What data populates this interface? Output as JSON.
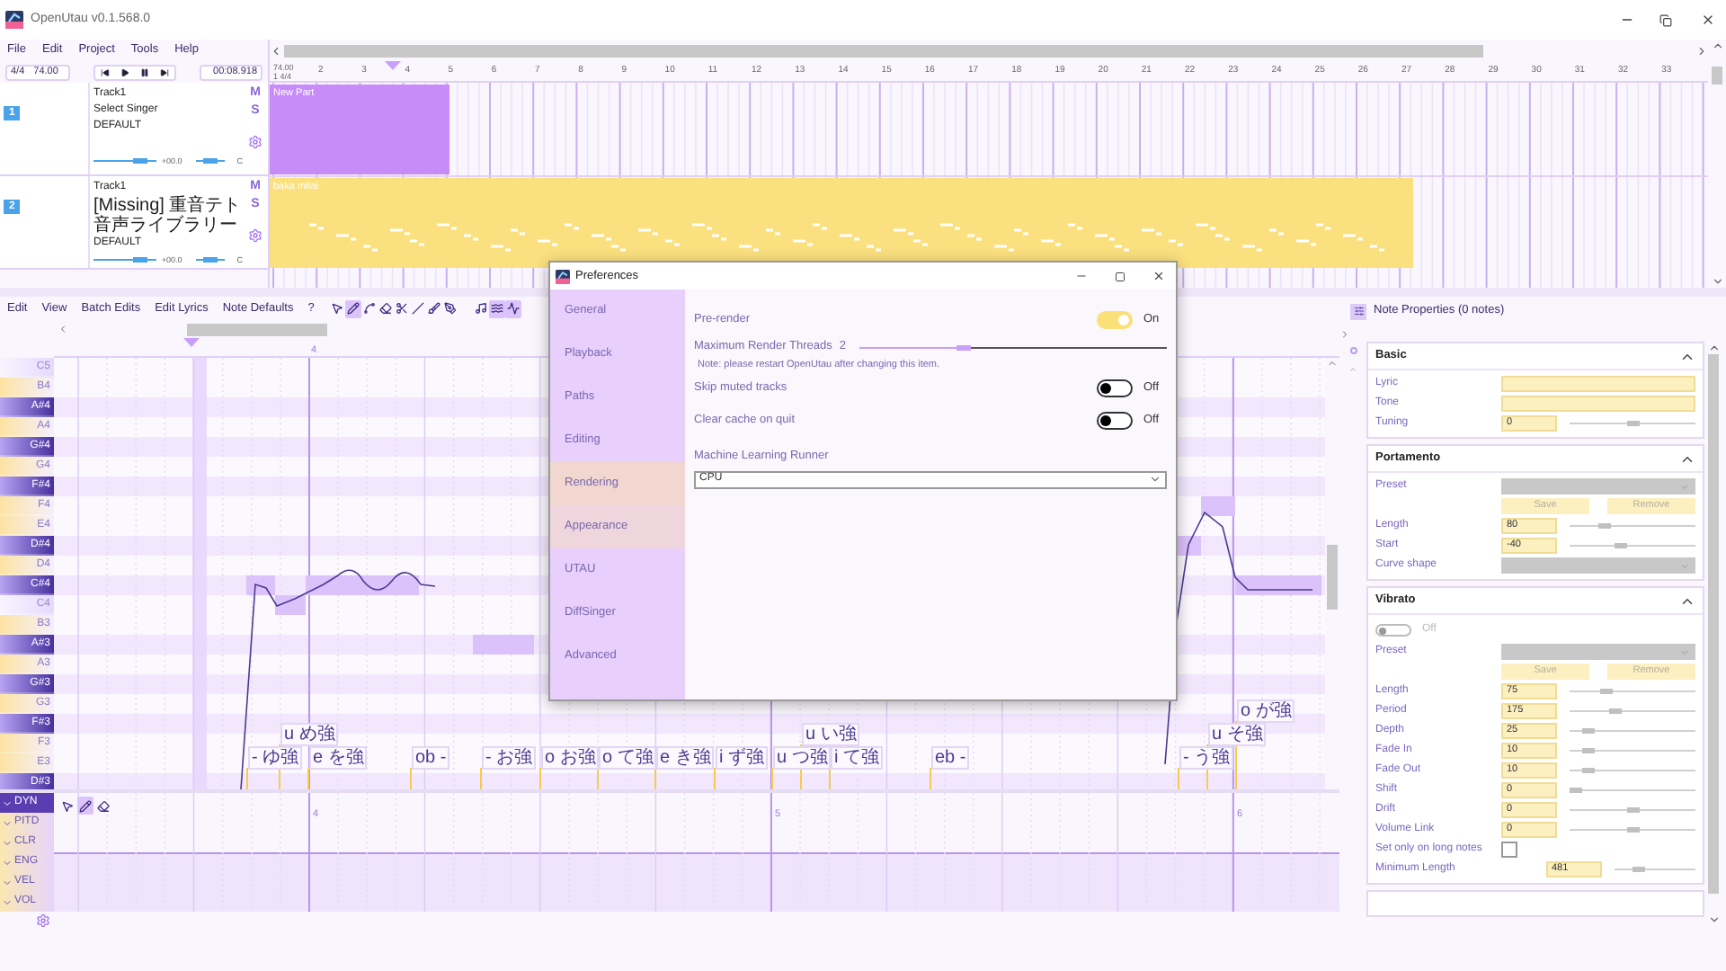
{
  "window": {
    "title": "OpenUtau v0.1.568.0"
  },
  "menu": [
    "File",
    "Edit",
    "Project",
    "Tools",
    "Help"
  ],
  "transport": {
    "time_signature": "4/4",
    "bpm": "74.00",
    "time": "00:08.918"
  },
  "timeline": {
    "tempo": "74.00",
    "start": "1 4/4",
    "bars": [
      "2",
      "3",
      "4",
      "5",
      "6",
      "7",
      "8",
      "9",
      "10",
      "11",
      "12",
      "13",
      "14",
      "15",
      "16",
      "17",
      "18",
      "19",
      "20",
      "21",
      "22",
      "23",
      "24",
      "25",
      "26",
      "27",
      "28",
      "29",
      "30",
      "31",
      "32",
      "33"
    ]
  },
  "tracks": [
    {
      "number": "1",
      "name": "Track1",
      "singer": "Select Singer",
      "renderer": "DEFAULT",
      "mute": "M",
      "solo": "S",
      "volume": {
        "reading": "+00.0",
        "level": 0.75
      },
      "pan": {
        "reading": "C",
        "level": 0.5
      },
      "part": {
        "name": "New Part",
        "color": "#c88cf8",
        "kind": "empty"
      }
    },
    {
      "number": "2",
      "name": "Track1",
      "singer": "[Missing] 重音テト音声ライブラリー",
      "renderer": "DEFAULT",
      "mute": "M",
      "solo": "S",
      "volume": {
        "reading": "+00.0",
        "level": 0.75
      },
      "pan": {
        "reading": "C",
        "level": 0.5
      },
      "part": {
        "name": "baka mitai",
        "color": "#fbe07f",
        "kind": "notes"
      }
    }
  ],
  "piano_roll": {
    "menu": [
      "Edit",
      "View",
      "Batch Edits",
      "Edit Lyrics",
      "Note Defaults"
    ],
    "help": "?",
    "bars": [
      "4"
    ],
    "tools": [
      {
        "kind": "pointer",
        "selected": false
      },
      {
        "kind": "pencil",
        "selected": true
      },
      {
        "kind": "curve",
        "selected": false
      },
      {
        "kind": "eraser",
        "selected": false
      },
      {
        "kind": "knife",
        "selected": false
      },
      {
        "kind": "line",
        "selected": false
      },
      {
        "kind": "brush",
        "selected": false
      },
      {
        "kind": "pen",
        "selected": false
      }
    ],
    "views": [
      {
        "kind": "note",
        "selected": false
      },
      {
        "kind": "wave",
        "selected": true
      },
      {
        "kind": "activity",
        "selected": true
      }
    ],
    "keys": [
      {
        "name": "C5",
        "kind": "c"
      },
      {
        "name": "B4",
        "kind": "white"
      },
      {
        "name": "A#4",
        "kind": "black"
      },
      {
        "name": "A4",
        "kind": "white"
      },
      {
        "name": "G#4",
        "kind": "black"
      },
      {
        "name": "G4",
        "kind": "white"
      },
      {
        "name": "F#4",
        "kind": "black"
      },
      {
        "name": "F4",
        "kind": "white"
      },
      {
        "name": "E4",
        "kind": "white"
      },
      {
        "name": "D#4",
        "kind": "black"
      },
      {
        "name": "D4",
        "kind": "white"
      },
      {
        "name": "C#4",
        "kind": "black"
      },
      {
        "name": "C4",
        "kind": "c"
      },
      {
        "name": "B3",
        "kind": "white"
      },
      {
        "name": "A#3",
        "kind": "black"
      },
      {
        "name": "A3",
        "kind": "white"
      },
      {
        "name": "G#3",
        "kind": "black"
      },
      {
        "name": "G3",
        "kind": "white"
      },
      {
        "name": "F#3",
        "kind": "black"
      },
      {
        "name": "F3",
        "kind": "white"
      },
      {
        "name": "E3",
        "kind": "white"
      },
      {
        "name": "D#3",
        "kind": "black"
      }
    ],
    "phonemes": [
      "- ゆ強",
      "u め強",
      "e を強",
      "ob -",
      "- お強",
      "o お強",
      "o て強",
      "e き強",
      "i ず強",
      "u つ強",
      "u い強",
      "i て強",
      "eb -",
      "- う強",
      "u そ強",
      "o が強"
    ]
  },
  "expressions": {
    "lanes": [
      {
        "name": "DYN",
        "selected": true
      },
      {
        "name": "PITD",
        "selected": false
      },
      {
        "name": "CLR",
        "selected": false
      },
      {
        "name": "ENG",
        "selected": false
      },
      {
        "name": "VEL",
        "selected": false
      },
      {
        "name": "VOL",
        "selected": false
      }
    ],
    "tools": [
      {
        "kind": "pointer",
        "selected": false
      },
      {
        "kind": "pencil",
        "selected": true
      },
      {
        "kind": "eraser",
        "selected": false
      }
    ],
    "bars": [
      "4",
      "5",
      "6"
    ]
  },
  "note_properties": {
    "title": "Note Properties (0 notes)",
    "sections": [
      {
        "title": "Basic",
        "rows": [
          {
            "kind": "text",
            "label": "Lyric"
          },
          {
            "kind": "text",
            "label": "Tone"
          },
          {
            "kind": "number",
            "label": "Tuning",
            "value": "0",
            "level": 0.5
          }
        ]
      },
      {
        "title": "Portamento",
        "rows": [
          {
            "kind": "dropdown",
            "label": "Preset"
          },
          {
            "kind": "buttons",
            "buttons": [
              "Save",
              "Remove"
            ]
          },
          {
            "kind": "number",
            "label": "Length",
            "value": "80",
            "level": 0.28
          },
          {
            "kind": "number",
            "label": "Start",
            "value": "-40",
            "level": 0.41
          },
          {
            "kind": "dropdown",
            "label": "Curve shape"
          }
        ]
      },
      {
        "title": "Vibrato",
        "rows": [
          {
            "kind": "toggle",
            "label": "Off",
            "on": false
          },
          {
            "kind": "dropdown",
            "label": "Preset"
          },
          {
            "kind": "buttons",
            "buttons": [
              "Save",
              "Remove"
            ]
          },
          {
            "kind": "number",
            "label": "Length",
            "value": "75",
            "level": 0.29
          },
          {
            "kind": "number",
            "label": "Period",
            "value": "175",
            "level": 0.36
          },
          {
            "kind": "number",
            "label": "Depth",
            "value": "25",
            "level": 0.15
          },
          {
            "kind": "number",
            "label": "Fade In",
            "value": "10",
            "level": 0.15
          },
          {
            "kind": "number",
            "label": "Fade Out",
            "value": "10",
            "level": 0.15
          },
          {
            "kind": "number",
            "label": "Shift",
            "value": "0",
            "level": 0.05
          },
          {
            "kind": "number",
            "label": "Drift",
            "value": "0",
            "level": 0.5
          },
          {
            "kind": "number",
            "label": "Volume Link",
            "value": "0",
            "level": 0.5
          },
          {
            "kind": "checkbox",
            "label": "Set only on long notes",
            "checked": false
          },
          {
            "kind": "number_wide",
            "label": "Minimum Length",
            "value": "481",
            "level": 0.3
          }
        ]
      }
    ]
  },
  "preferences": {
    "title": "Preferences",
    "nav": [
      {
        "label": "General",
        "selected": false,
        "hovered": false
      },
      {
        "label": "Playback",
        "selected": false,
        "hovered": false
      },
      {
        "label": "Paths",
        "selected": false,
        "hovered": false
      },
      {
        "label": "Editing",
        "selected": false,
        "hovered": false
      },
      {
        "label": "Rendering",
        "selected": true,
        "hovered": false
      },
      {
        "label": "Appearance",
        "selected": false,
        "hovered": true
      },
      {
        "label": "UTAU",
        "selected": false,
        "hovered": false
      },
      {
        "label": "DiffSinger",
        "selected": false,
        "hovered": false
      },
      {
        "label": "Advanced",
        "selected": false,
        "hovered": false
      }
    ],
    "settings": [
      {
        "kind": "toggle",
        "label": "Pre-render",
        "on": true,
        "state": "On"
      },
      {
        "kind": "slider",
        "label": "Maximum Render Threads",
        "value": "2",
        "level": 0.34
      },
      {
        "kind": "note",
        "text": "Note: please restart OpenUtau after changing this item."
      },
      {
        "kind": "toggle",
        "label": "Skip muted tracks",
        "on": false,
        "state": "Off"
      },
      {
        "kind": "toggle",
        "label": "Clear cache on quit",
        "on": false,
        "state": "Off"
      },
      {
        "kind": "select",
        "label": "Machine Learning Runner",
        "value": "CPU"
      }
    ]
  }
}
